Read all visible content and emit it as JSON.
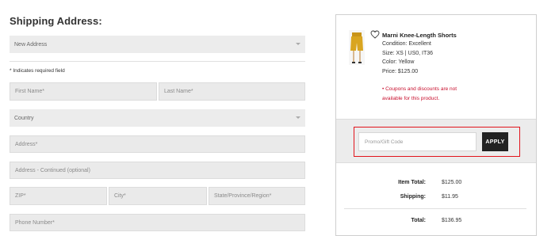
{
  "form": {
    "title": "Shipping Address:",
    "address_select": "New Address",
    "required_note": "* Indicates required field",
    "first_name_placeholder": "First Name*",
    "last_name_placeholder": "Last Name*",
    "country_select": "Country",
    "address_placeholder": "Address*",
    "address2_placeholder": "Address - Continued (optional)",
    "zip_placeholder": "ZIP*",
    "city_placeholder": "City*",
    "state_placeholder": "State/Province/Region*",
    "phone_placeholder": "Phone Number*"
  },
  "product": {
    "name": "Marni Knee-Length Shorts",
    "condition": "Condition: Excellent",
    "size": "Size: XS | US0, IT36",
    "color": "Color: Yellow",
    "price": "Price: $125.00",
    "coupon_note_line1": "• Coupons and discounts are not",
    "coupon_note_line2": "available for this product."
  },
  "promo": {
    "placeholder": "Promo/Gift Code",
    "apply_label": "APPLY"
  },
  "summary": {
    "item_total_label": "Item Total:",
    "item_total_value": "$125.00",
    "shipping_label": "Shipping:",
    "shipping_value": "$11.95",
    "total_label": "Total:",
    "total_value": "$136.95"
  },
  "colors": {
    "highlight_box": "#e2141c",
    "coupon_text": "#c8102e",
    "apply_button": "#222222",
    "product_yellow": "#d9a520"
  },
  "icons": {
    "wishlist": "heart-outline-icon",
    "dropdown": "chevron-down-icon"
  }
}
